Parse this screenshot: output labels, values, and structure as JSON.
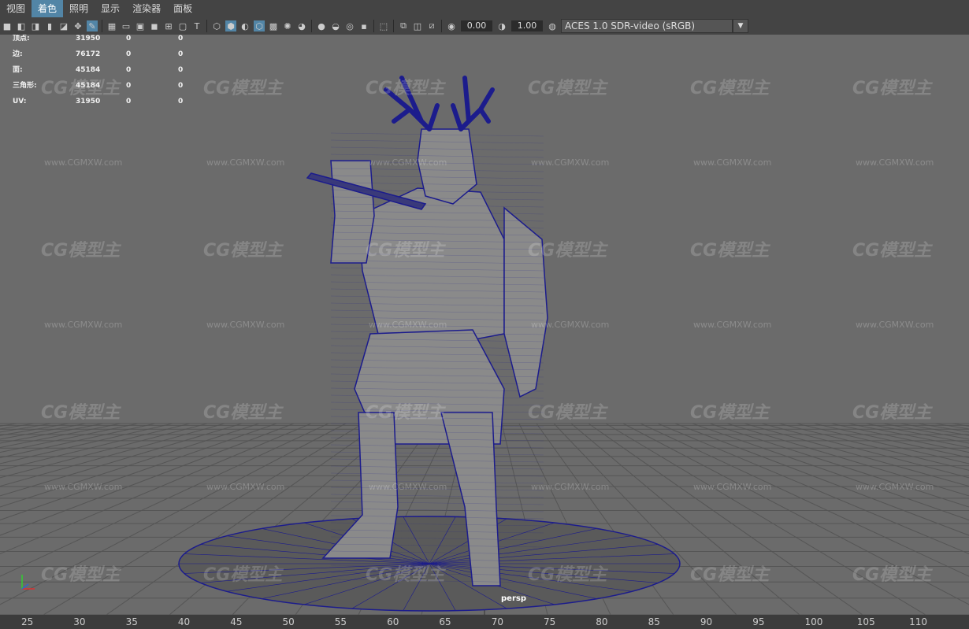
{
  "menu": [
    "视图",
    "着色",
    "照明",
    "显示",
    "渲染器",
    "面板"
  ],
  "active_menu_index": 1,
  "toolbar": {
    "exposure_value": "0.00",
    "gamma_value": "1.00",
    "color_space": "ACES 1.0 SDR-video (sRGB)"
  },
  "hud": {
    "rows": [
      {
        "label": "顶点:",
        "value": "31950",
        "a": "0",
        "b": "0"
      },
      {
        "label": "边:",
        "value": "76172",
        "a": "0",
        "b": "0"
      },
      {
        "label": "面:",
        "value": "45184",
        "a": "0",
        "b": "0"
      },
      {
        "label": "三角形:",
        "value": "45184",
        "a": "0",
        "b": "0"
      },
      {
        "label": "UV:",
        "value": "31950",
        "a": "0",
        "b": "0"
      }
    ]
  },
  "camera": "persp",
  "watermark": {
    "logo_text": "CG模型主",
    "url": "www.CGMXW.com"
  },
  "ruler_ticks": [
    "25",
    "30",
    "35",
    "40",
    "45",
    "50",
    "55",
    "60",
    "65",
    "70",
    "75",
    "80",
    "85",
    "90",
    "95",
    "100",
    "105",
    "110"
  ],
  "colors": {
    "viewport_bg": "#6b6b6b",
    "wireframe": "#1c1c8c",
    "accent": "#5285a6"
  }
}
